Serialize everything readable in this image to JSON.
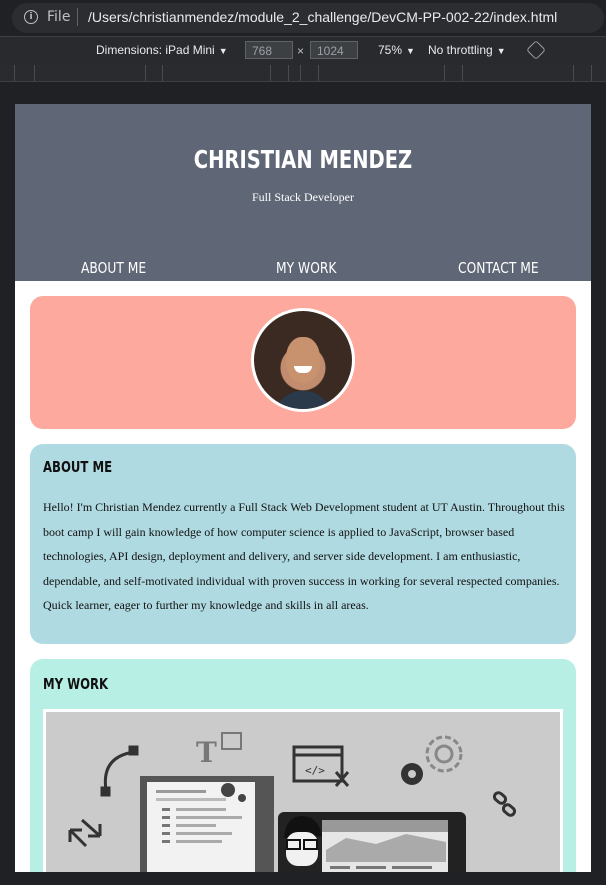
{
  "browser": {
    "address": {
      "scheme_label": "File",
      "url": "/Users/christianmendez/module_2_challenge/DevCM-PP-002-22/index.html"
    },
    "device_toolbar": {
      "dimensions_label": "Dimensions: iPad Mini",
      "width_value": "768",
      "height_value": "1024",
      "times": "×",
      "zoom": "75%",
      "throttling": "No throttling"
    }
  },
  "site": {
    "title": "CHRISTIAN MENDEZ",
    "subtitle": "Full Stack Developer",
    "nav": [
      "ABOUT ME",
      "MY WORK",
      "CONTACT ME"
    ],
    "about": {
      "heading": "ABOUT ME",
      "body": "Hello! I'm Christian Mendez currently a Full Stack Web Development student at UT Austin. Throughout this boot camp I will gain knowledge of how computer science is applied to JavaScript, browser based technologies, API design, deployment and delivery, and server side development. I am enthusiastic, dependable, and self-motivated individual with proven success in working for several respected companies. Quick learner, eager to further my knowledge and skills in all areas."
    },
    "work": {
      "heading": "MY WORK",
      "illustration_glyphs": {
        "type_letter": "T",
        "code_tag": "</>"
      }
    },
    "colors": {
      "header": "#5f6675",
      "hero_card": "#fea99e",
      "about_card": "#b0dae1",
      "work_card": "#b8efe5"
    }
  }
}
